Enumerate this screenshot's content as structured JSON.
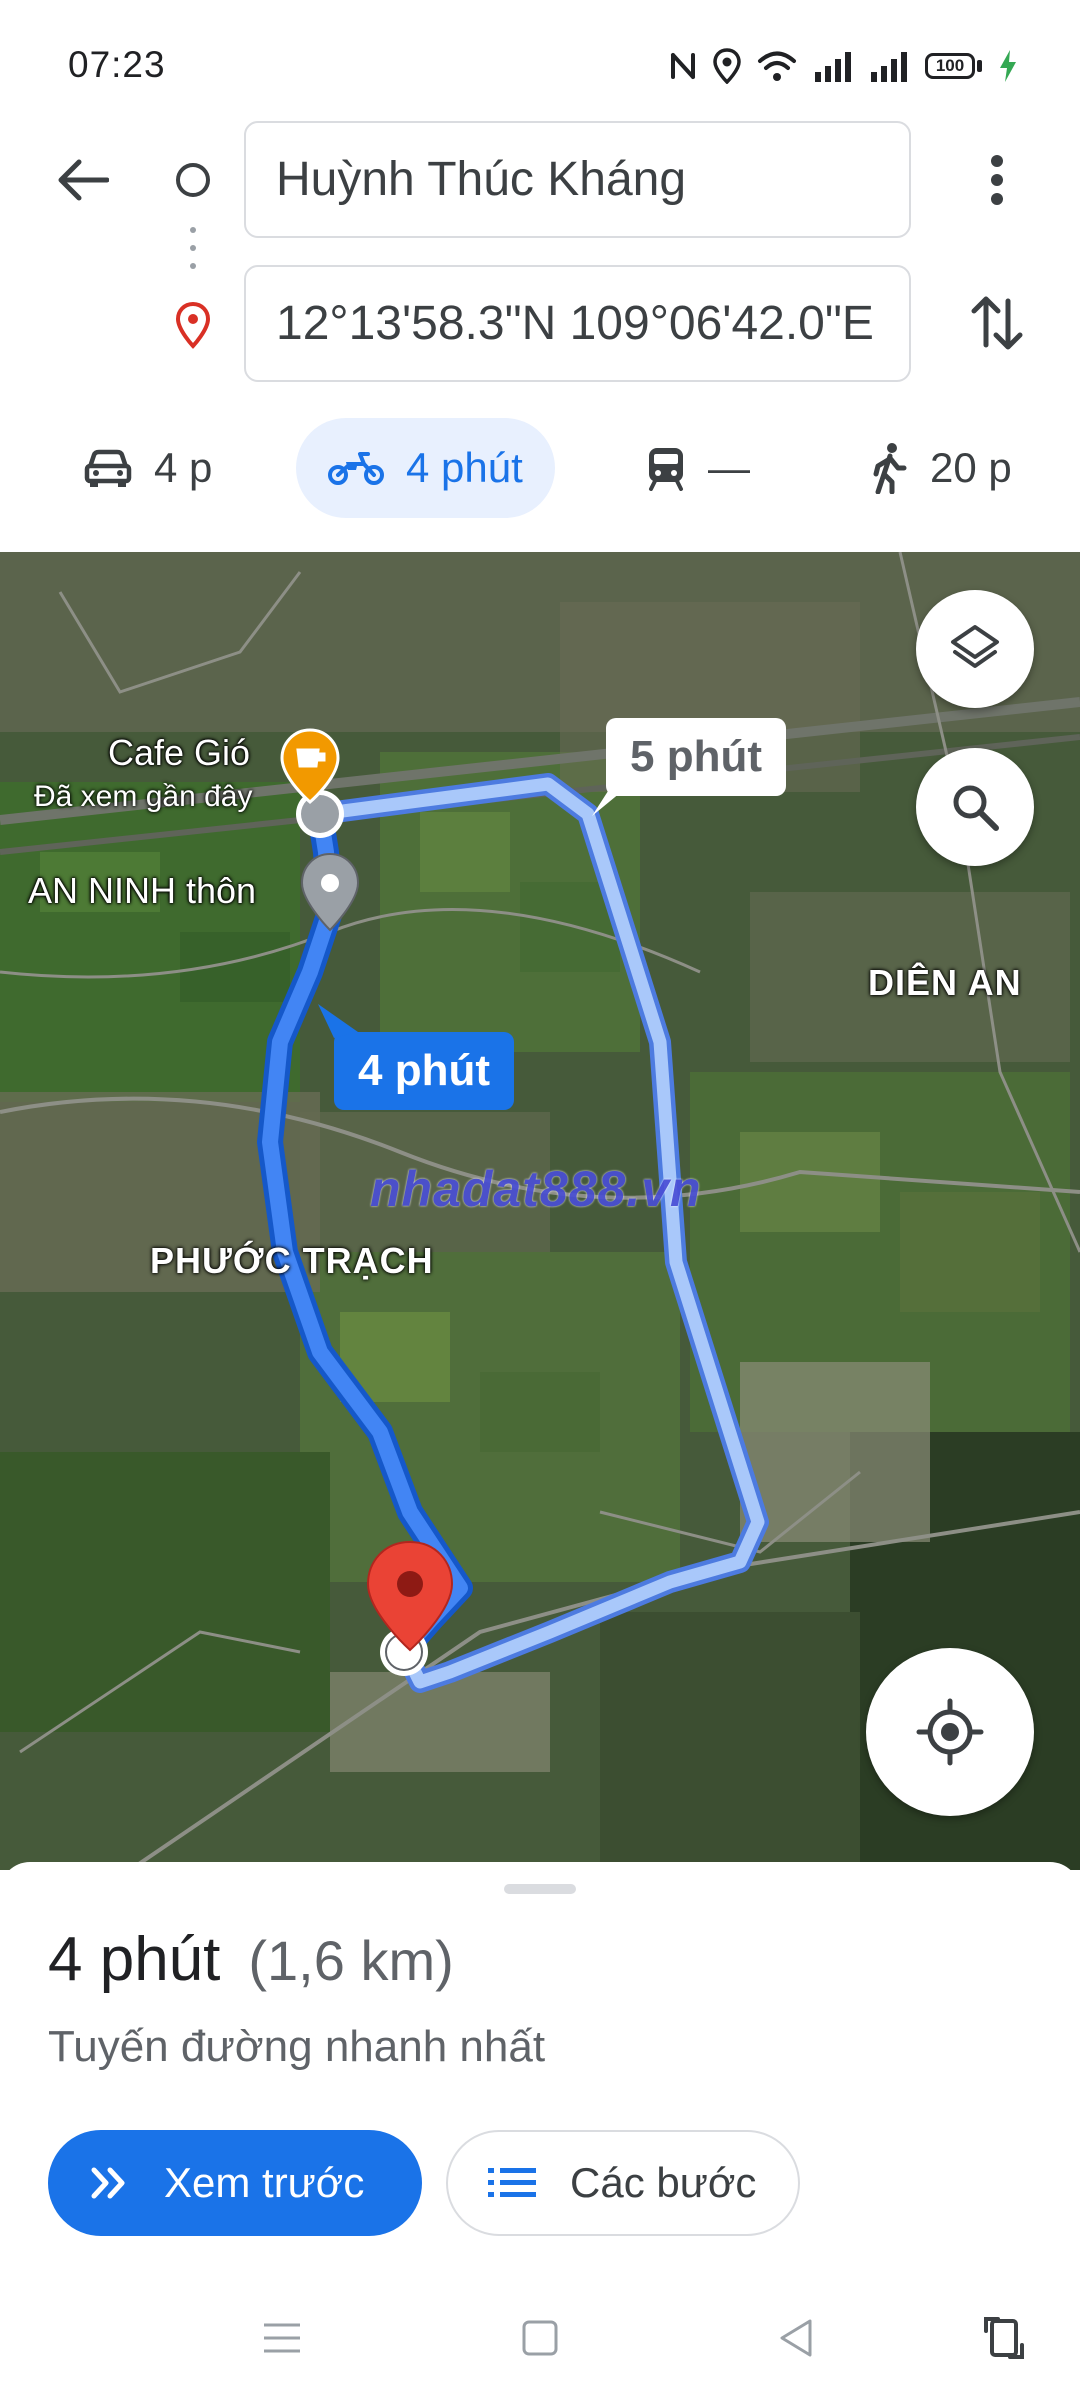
{
  "status_bar": {
    "time": "07:23",
    "battery": "100",
    "icons": [
      "nfc-icon",
      "location-icon",
      "wifi-icon",
      "signal-icon",
      "signal-icon",
      "battery-icon",
      "charging-icon"
    ]
  },
  "directions": {
    "origin": "Huỳnh Thúc Kháng",
    "destination": "12°13'58.3\"N 109°06'42.0\"E"
  },
  "modes": [
    {
      "icon": "car-icon",
      "label": "4 p",
      "active": false
    },
    {
      "icon": "motorbike-icon",
      "label": "4 phút",
      "active": true
    },
    {
      "icon": "transit-icon",
      "label": "—",
      "active": false
    },
    {
      "icon": "walk-icon",
      "label": "20 p",
      "active": false
    }
  ],
  "map": {
    "place_label": "Cafe Gió",
    "place_sublabel": "Đã xem gần đây",
    "poi_label": "AN NINH thôn",
    "area_labels": [
      "DIÊN AN",
      "PHƯỚC TRẠCH"
    ],
    "route_main_time": "4 phút",
    "route_alt_time": "5 phút",
    "watermark": "nhadat888.vn",
    "colors": {
      "route_main": "#1a73e8",
      "route_alt": "#8ab4f8",
      "pin": "#ea4335",
      "cafe_pin": "#f29900"
    }
  },
  "sheet": {
    "duration": "4 phút",
    "distance": "(1,6 km)",
    "note": "Tuyến đường nhanh nhất",
    "preview_label": "Xem trước",
    "steps_label": "Các bước"
  }
}
